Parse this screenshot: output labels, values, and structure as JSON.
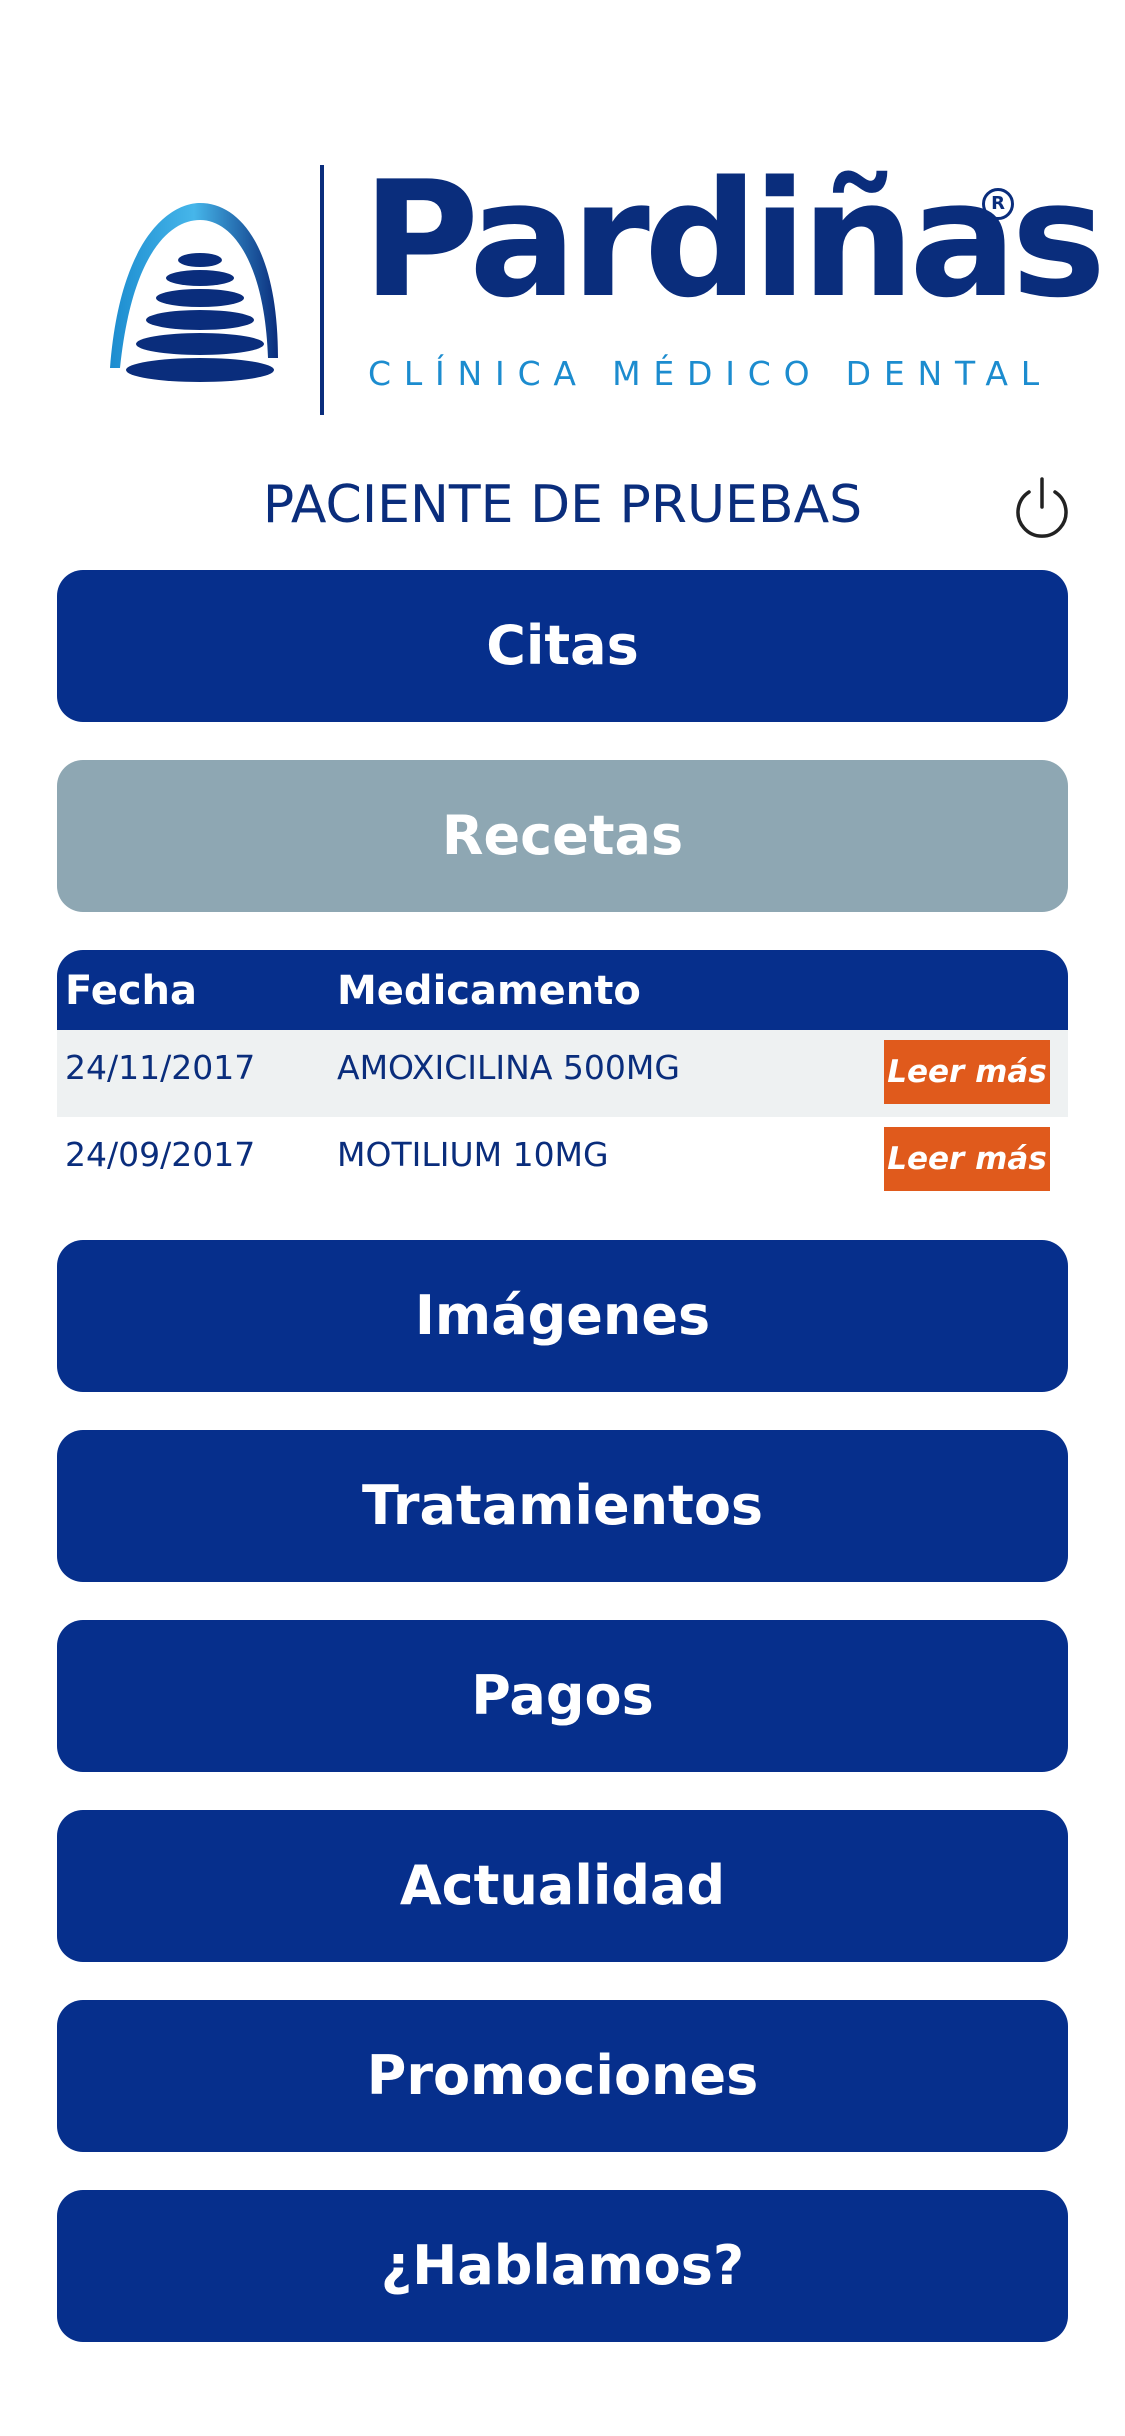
{
  "brand": {
    "name": "Pardiñas",
    "registered_mark": "R",
    "tagline": "CLÍNICA MÉDICO DENTAL",
    "primary_color": "#0a2d7c",
    "accent_color": "#1c8ccf"
  },
  "patient": {
    "name": "PACIENTE DE PRUEBAS",
    "power_icon": "power-icon"
  },
  "menu": {
    "citas": "Citas",
    "recetas": "Recetas",
    "imagenes": "Imágenes",
    "tratamientos": "Tratamientos",
    "pagos": "Pagos",
    "actualidad": "Actualidad",
    "promociones": "Promociones",
    "hablamos": "¿Hablamos?"
  },
  "prescriptions": {
    "headers": {
      "date": "Fecha",
      "medication": "Medicamento"
    },
    "rows": [
      {
        "date": "24/11/2017",
        "medication": "AMOXICILINA 500MG",
        "action": "Leer más"
      },
      {
        "date": "24/09/2017",
        "medication": "MOTILIUM 10MG",
        "action": "Leer más"
      }
    ]
  },
  "colors": {
    "button": "#062f8c",
    "button_active": "#8ea7b3",
    "read_more": "#e05a1c"
  }
}
